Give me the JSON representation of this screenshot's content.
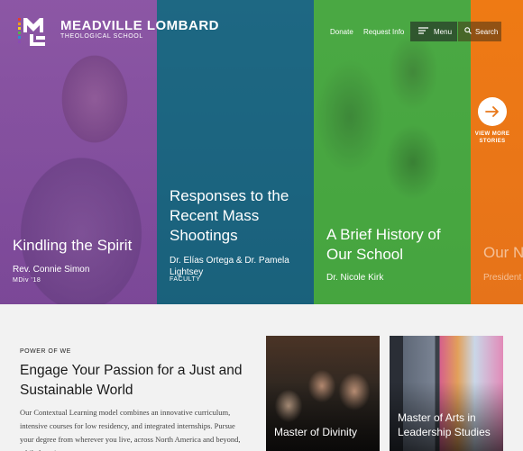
{
  "header": {
    "brand_name": "MEADVILLE LOMBARD",
    "brand_sub": "THEOLOGICAL SCHOOL",
    "nav": {
      "donate": "Donate",
      "request_info": "Request Info",
      "menu": "Menu",
      "search": "Search"
    }
  },
  "hero": {
    "panels": [
      {
        "title": "Kindling the Spirit",
        "name": "Rev. Connie Simon",
        "sub": "MDiv ’18",
        "color": "#9a52b8"
      },
      {
        "title": "Responses to the Recent Mass Shootings",
        "name": "Dr. Elías Ortega & Dr. Pamela Lightsey",
        "sub": "FACULTY",
        "color": "#1f6f8b"
      },
      {
        "title": "A Brief History of Our School",
        "name": "Dr. Nicole Kirk",
        "sub": "",
        "color": "#4aa944"
      },
      {
        "title": "Our N",
        "name": "President S",
        "sub": "",
        "color": "#ec7a16"
      }
    ],
    "view_more": "VIEW MORE STORIES"
  },
  "intro": {
    "eyebrow": "POWER OF WE",
    "headline": "Engage Your Passion for a Just and Sustainable World",
    "body": "Our Contextual Learning model combines an innovative curriculum, intensive courses for low residency, and integrated internships. Pursue your degree from wherever you live, across North America and beyond, while learning"
  },
  "programs": [
    {
      "title": "Master of Divinity"
    },
    {
      "title": "Master of Arts in Leadership Studies"
    }
  ],
  "colors": {
    "purple": "#9a52b8",
    "teal": "#1f6f8b",
    "green": "#4aa944",
    "orange": "#ec7a16"
  }
}
